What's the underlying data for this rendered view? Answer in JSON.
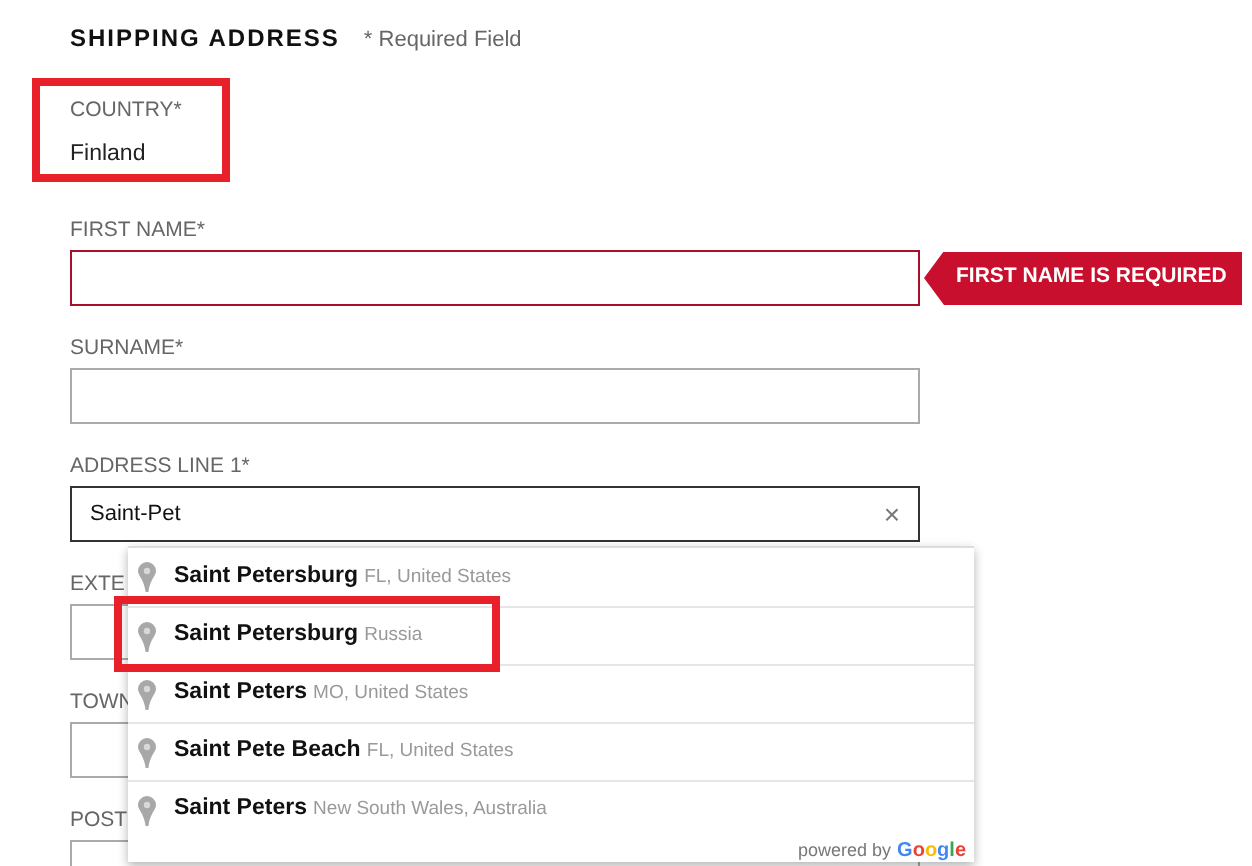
{
  "heading": {
    "title": "SHIPPING ADDRESS",
    "note": "* Required Field"
  },
  "country": {
    "label": "COUNTRY*",
    "value": "Finland",
    "highlighted": true
  },
  "fields": [
    {
      "label": "FIRST NAME*",
      "invalid": true,
      "error": "FIRST NAME IS REQUIRED",
      "focused": false
    },
    {
      "label": "SURNAME*",
      "invalid": false,
      "focused": false
    },
    {
      "label": "ADDRESS LINE 1*",
      "value": "Saint-Pet",
      "invalid": false,
      "focused": true,
      "clear": "×"
    },
    {
      "label": "EXTE",
      "invalid": false,
      "focused": false
    },
    {
      "label": "TOWN",
      "invalid": false,
      "focused": false
    },
    {
      "label": "POST",
      "invalid": false,
      "focused": false
    }
  ],
  "suggestions": [
    {
      "name": "Saint Petersburg",
      "detail": "FL, United States",
      "highlighted": false
    },
    {
      "name": "Saint Petersburg",
      "detail": "Russia",
      "highlighted": true
    },
    {
      "name": "Saint Peters",
      "detail": "MO, United States",
      "highlighted": false
    },
    {
      "name": "Saint Pete Beach",
      "detail": "FL, United States",
      "highlighted": false
    },
    {
      "name": "Saint Peters",
      "detail": "New South Wales, Australia",
      "highlighted": false
    }
  ],
  "attribution": {
    "text": "powered by",
    "brand": "Google"
  }
}
